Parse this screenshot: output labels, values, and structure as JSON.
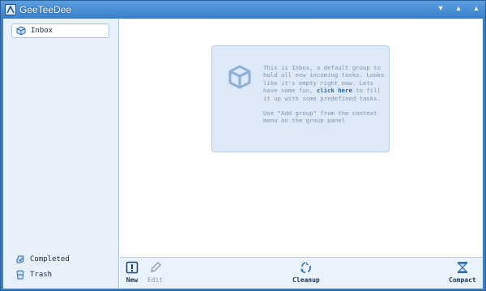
{
  "window": {
    "title": "GeeTeeDee",
    "controls": [
      "▾",
      "▴",
      "▴"
    ]
  },
  "sidebar": {
    "groups": [
      {
        "label": "Inbox",
        "icon": "inbox-cube-icon",
        "selected": true
      }
    ],
    "bottom": [
      {
        "label": "Completed",
        "icon": "completed-icon"
      },
      {
        "label": "Trash",
        "icon": "trash-icon"
      }
    ]
  },
  "hint": {
    "text_before_link": "This is Inbox, a default group to hold all new incoming tasks. Looks like it's empty right now. Lets have some fun, ",
    "link": "click here",
    "text_after_link": " to fill it up with some predefined tasks.",
    "text_2": "Use \"Add group\" from the context menu on the group panel"
  },
  "toolbar": {
    "new_label": "New",
    "edit_label": "Edit",
    "cleanup_label": "Cleanup",
    "compact_label": "Compact"
  },
  "colors": {
    "titlebar": "#3a7fc8",
    "sidebar": "#e8f1fb",
    "hint_bg": "#dde9f7",
    "link": "#1f5fa8"
  }
}
